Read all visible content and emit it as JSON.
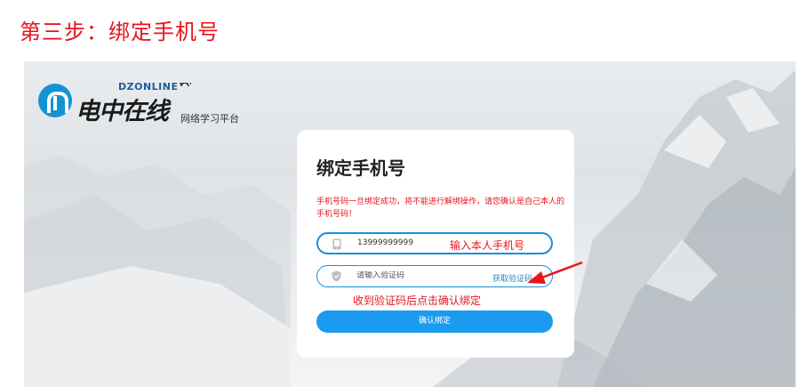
{
  "step_title": "第三步：绑定手机号",
  "logo": {
    "en": "DZONLINE",
    "cn": "电中在线",
    "subtitle": "网络学习平台"
  },
  "card": {
    "title": "绑定手机号",
    "warning": "手机号码一旦绑定成功，将不能进行解绑操作，请您确认是自己本人的手机号码！",
    "phone": {
      "value": "13999999999"
    },
    "code": {
      "placeholder": "请输入验证码",
      "get_code_label": "获取验证码"
    },
    "confirm_label": "确认绑定"
  },
  "annotations": {
    "phone_hint": "输入本人手机号",
    "code_hint": "收到验证码后点击确认绑定"
  },
  "colors": {
    "annotation_red": "#e8141c",
    "accent_blue": "#1b9bf0",
    "link_blue": "#2a86c8"
  }
}
